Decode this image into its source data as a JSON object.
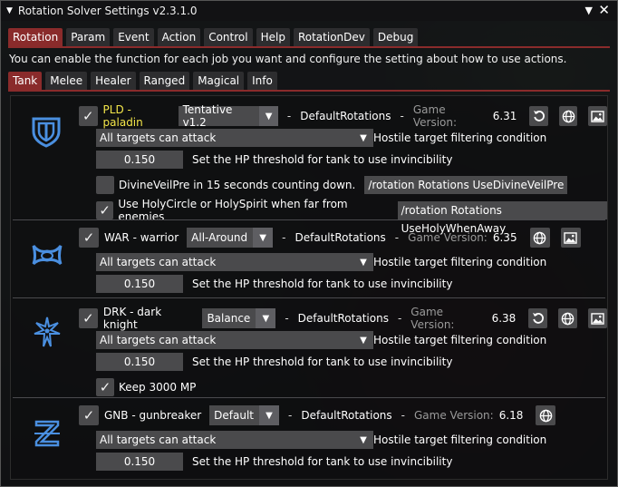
{
  "window": {
    "title": "Rotation Solver Settings v2.3.1.0"
  },
  "tabs": [
    "Rotation",
    "Param",
    "Event",
    "Action",
    "Control",
    "Help",
    "RotationDev",
    "Debug"
  ],
  "description": "You can enable the function for each job you want and configure the setting about how to use actions.",
  "subtabs": [
    "Tank",
    "Melee",
    "Healer",
    "Ranged",
    "Magical",
    "Info"
  ],
  "common": {
    "filter_value": "All targets can attack",
    "filter_label": "Hostile target filtering condition",
    "threshold_value": "0.150",
    "threshold_label": "Set the HP threshold for tank to use invincibility",
    "dash": "-",
    "rotations": "DefaultRotations",
    "dash2": "-",
    "gv_label": "Game Version:"
  },
  "jobs": [
    {
      "name": "PLD - paladin",
      "rotation": "Tentative v1.2",
      "version": "6.31",
      "options": [
        {
          "label": "DivineVeilPre in 15 seconds counting down.",
          "checked": false,
          "command": "/rotation Rotations UseDivineVeilPre"
        },
        {
          "label": "Use HolyCircle or HolySpirit when far from enemies",
          "checked": true,
          "command": "/rotation Rotations UseHolyWhenAway"
        }
      ]
    },
    {
      "name": "WAR - warrior",
      "rotation": "All-Around",
      "version": "6.35"
    },
    {
      "name": "DRK - dark knight",
      "rotation": "Balance",
      "version": "6.38",
      "options": [
        {
          "label": "Keep 3000 MP",
          "checked": true
        }
      ]
    },
    {
      "name": "GNB - gunbreaker",
      "rotation": "Default",
      "version": "6.18"
    }
  ],
  "icons": {
    "reset": "reset-icon",
    "globe": "globe-icon",
    "image": "image-icon",
    "pld": "paladin-job-icon",
    "war": "warrior-job-icon",
    "drk": "dark-knight-job-icon",
    "gnb": "gunbreaker-job-icon"
  },
  "colors": {
    "accent": "#8a2b2b",
    "job_icon": "#4a8fe0",
    "selected_job": "#f3e64a"
  }
}
